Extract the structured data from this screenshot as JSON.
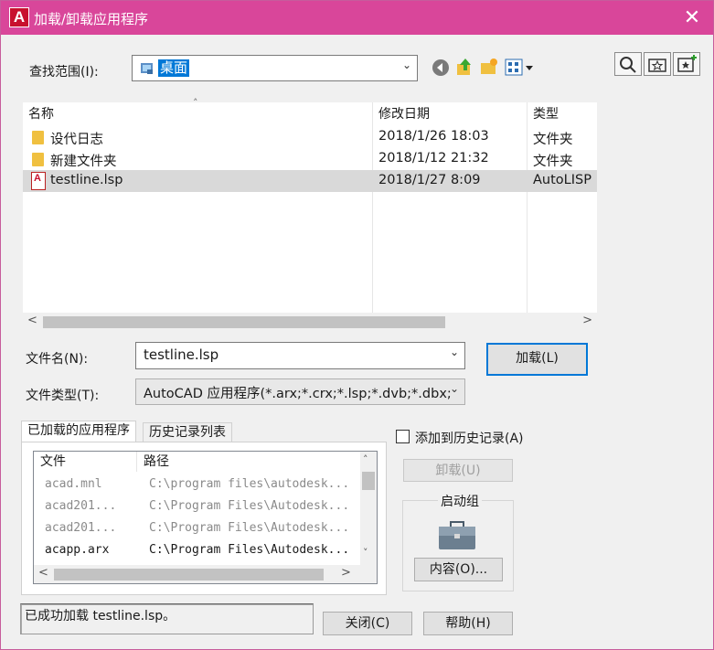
{
  "window": {
    "title": "加载/卸载应用程序",
    "close_glyph": "✕",
    "accent": "#d9469a"
  },
  "lookin": {
    "label": "查找范围(I):",
    "value": "桌面"
  },
  "file_list": {
    "columns": [
      "名称",
      "修改日期",
      "类型"
    ],
    "rows": [
      {
        "name": "设代日志",
        "date": "2018/1/26 18:03",
        "type": "文件夹",
        "icon": "folder-icon"
      },
      {
        "name": "新建文件夹",
        "date": "2018/1/12 21:32",
        "type": "文件夹",
        "icon": "folder-icon"
      },
      {
        "name": "testline.lsp",
        "date": "2018/1/27 8:09",
        "type": "AutoLISP",
        "icon": "lsp-file-icon"
      }
    ]
  },
  "filename": {
    "label": "文件名(N):",
    "value": "testline.lsp"
  },
  "filetype": {
    "label": "文件类型(T):",
    "value": "AutoCAD 应用程序(*.arx;*.crx;*.lsp;*.dvb;*.dbx;"
  },
  "buttons": {
    "load": "加载(L)",
    "unload": "卸载(U)",
    "contents": "内容(O)...",
    "close": "关闭(C)",
    "help": "帮助(H)"
  },
  "tabs": {
    "loaded": "已加载的应用程序",
    "history": "历史记录列表"
  },
  "app_list": {
    "columns": [
      "文件",
      "路径"
    ],
    "rows": [
      {
        "file": "acad.mnl",
        "path": "C:\\program files\\autodesk...",
        "dim": true
      },
      {
        "file": "acad201...",
        "path": "C:\\Program Files\\Autodesk...",
        "dim": true
      },
      {
        "file": "acad201...",
        "path": "C:\\Program Files\\Autodesk...",
        "dim": true
      },
      {
        "file": "acapp.arx",
        "path": "C:\\Program Files\\Autodesk...",
        "dim": false
      }
    ]
  },
  "history_checkbox": {
    "label": "添加到历史记录(A)",
    "checked": false
  },
  "startup_group": {
    "title": "启动组"
  },
  "status": {
    "text": "已成功加载 testline.lsp。"
  }
}
